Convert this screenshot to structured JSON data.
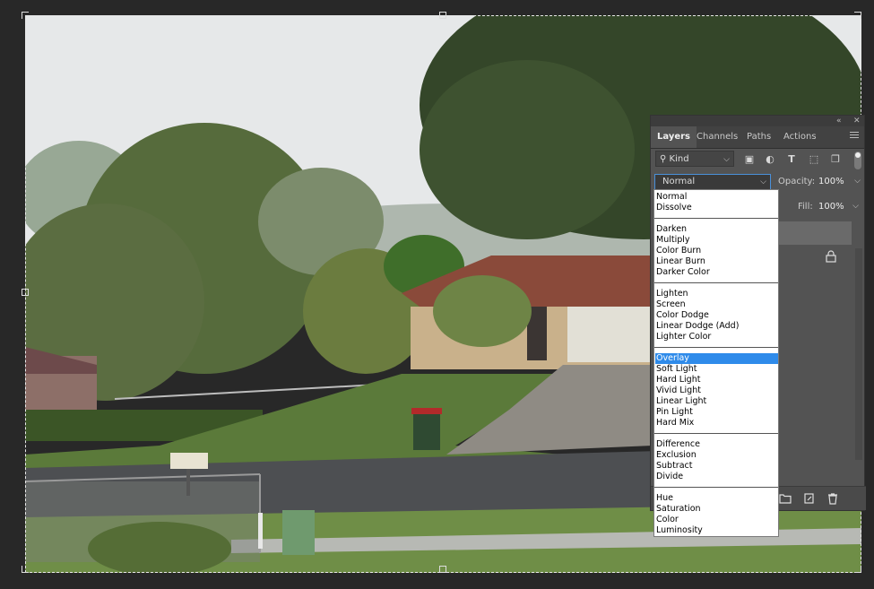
{
  "panel": {
    "tabs": [
      {
        "label": "Layers",
        "active": true
      },
      {
        "label": "Channels",
        "active": false
      },
      {
        "label": "Paths",
        "active": false
      },
      {
        "label": "Actions",
        "active": false
      }
    ],
    "filter": {
      "kind_label": "Kind"
    },
    "blend_mode": "Normal",
    "opacity": {
      "label": "Opacity:",
      "value": "100%"
    },
    "fill": {
      "label": "Fill:",
      "value": "100%"
    }
  },
  "blend_dropdown": {
    "groups": [
      [
        "Normal",
        "Dissolve"
      ],
      [
        "Darken",
        "Multiply",
        "Color Burn",
        "Linear Burn",
        "Darker Color"
      ],
      [
        "Lighten",
        "Screen",
        "Color Dodge",
        "Linear Dodge (Add)",
        "Lighter Color"
      ],
      [
        "Overlay",
        "Soft Light",
        "Hard Light",
        "Vivid Light",
        "Linear Light",
        "Pin Light",
        "Hard Mix"
      ],
      [
        "Difference",
        "Exclusion",
        "Subtract",
        "Divide"
      ],
      [
        "Hue",
        "Saturation",
        "Color",
        "Luminosity"
      ]
    ],
    "highlighted": "Overlay"
  },
  "colors": {
    "accent": "#2f8bea",
    "panel_bg": "#535353",
    "app_bg": "#282828"
  },
  "icons": [
    "search-icon",
    "image-filter-icon",
    "adjustment-filter-icon",
    "type-filter-icon",
    "shape-filter-icon",
    "smart-object-filter-icon",
    "lock-icon",
    "folder-icon",
    "new-layer-icon",
    "trash-icon",
    "panel-menu-icon"
  ]
}
